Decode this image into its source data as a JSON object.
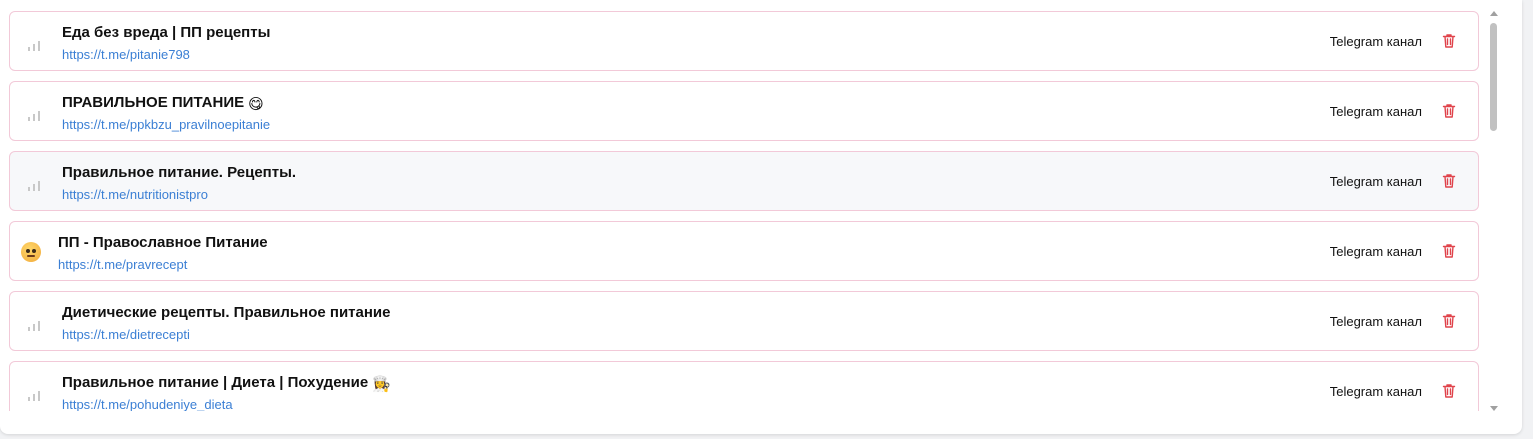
{
  "channels": [
    {
      "title": "Еда без вреда | ПП рецепты",
      "title_emoji": "",
      "link": "https://t.me/pitanie798",
      "type": "Telegram канал",
      "avatar": "signal-icon"
    },
    {
      "title": "ПРАВИЛЬНОЕ ПИТАНИЕ",
      "title_emoji": "😋",
      "link": "https://t.me/ppkbzu_pravilnoepitanie",
      "type": "Telegram канал",
      "avatar": "signal-icon"
    },
    {
      "title": "Правильное питание. Рецепты.",
      "title_emoji": "",
      "link": "https://t.me/nutritionistpro",
      "type": "Telegram канал",
      "avatar": "signal-icon"
    },
    {
      "title": "ПП - Православное Питание",
      "title_emoji": "",
      "link": "https://t.me/pravrecept",
      "type": "Telegram канал",
      "avatar": "face-emoji-icon"
    },
    {
      "title": "Диетические рецепты. Правильное питание",
      "title_emoji": "",
      "link": "https://t.me/dietrecepti",
      "type": "Telegram канал",
      "avatar": "signal-icon"
    },
    {
      "title": "Правильное питание | Диета | Похудение",
      "title_emoji": "👩‍🍳",
      "link": "https://t.me/pohudeniye_dieta",
      "type": "Telegram канал",
      "avatar": "signal-icon"
    }
  ],
  "colors": {
    "row_border": "#f2c9d8",
    "link": "#3b7fd4",
    "delete": "#e0434b",
    "hover_row": "#f7f8fa"
  }
}
